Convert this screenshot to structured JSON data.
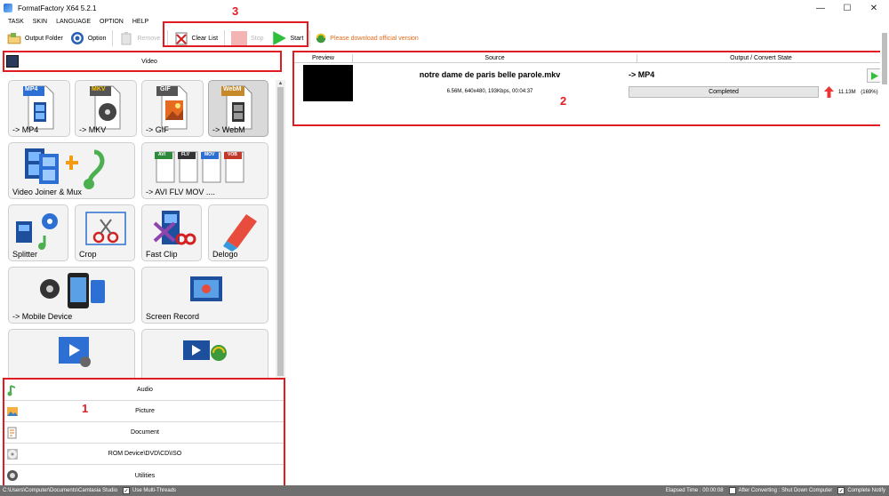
{
  "window": {
    "title": "FormatFactory X64 5.2.1",
    "controls": {
      "minimize": "—",
      "maximize": "☐",
      "close": "✕"
    }
  },
  "menu": [
    "TASK",
    "SKIN",
    "LANGUAGE",
    "OPTION",
    "HELP"
  ],
  "toolbar": {
    "output_folder": "Output Folder",
    "option": "Option",
    "remove": "Remove",
    "clear_list": "Clear List",
    "stop": "Stop",
    "start": "Start",
    "notice": "Please download official version"
  },
  "annotations": {
    "one": "1",
    "two": "2",
    "three": "3"
  },
  "left": {
    "header": "Video",
    "tiles": [
      {
        "label": "-> MP4",
        "badge": "MP4",
        "icon": "mp4-icon"
      },
      {
        "label": "-> MKV",
        "badge": "MKV",
        "icon": "mkv-icon"
      },
      {
        "label": "-> GIF",
        "badge": "GIF",
        "icon": "gif-icon"
      },
      {
        "label": "-> WebM",
        "badge": "WebM",
        "icon": "webm-icon",
        "selected": true
      },
      {
        "label": "Video Joiner & Mux",
        "icon": "video-joiner-icon"
      },
      {
        "label": "-> AVI FLV MOV ....",
        "icon": "avi-flv-mov-icon",
        "badges": [
          "AVI",
          "FLV",
          "MOV",
          "VOB"
        ]
      },
      {
        "label": "Splitter",
        "icon": "splitter-icon"
      },
      {
        "label": "Crop",
        "icon": "crop-icon"
      },
      {
        "label": "Fast Clip",
        "icon": "fast-clip-icon"
      },
      {
        "label": "Delogo",
        "icon": "delogo-icon"
      },
      {
        "label": "-> Mobile Device",
        "icon": "mobile-device-icon"
      },
      {
        "label": "Screen Record",
        "icon": "screen-record-icon"
      },
      {
        "label": "",
        "icon": "video-player-icon"
      },
      {
        "label": "",
        "icon": "video-download-icon"
      }
    ],
    "categories": [
      {
        "label": "Audio",
        "icon": "music-note-icon"
      },
      {
        "label": "Picture",
        "icon": "picture-icon"
      },
      {
        "label": "Document",
        "icon": "document-icon"
      },
      {
        "label": "ROM Device\\DVD\\CD\\ISO",
        "icon": "disc-icon"
      },
      {
        "label": "Utilities",
        "icon": "utilities-icon"
      }
    ]
  },
  "tasks": {
    "columns": [
      "Preview",
      "Source",
      "Output / Convert State"
    ],
    "items": [
      {
        "filename": "notre dame de paris belle parole.mkv",
        "info": "6.56M, 640x480, 193Kbps, 00:04:37",
        "target": "-> MP4",
        "state": "Completed",
        "progress": 1.0,
        "output_size": "11.13M",
        "ratio": "(169%)"
      }
    ]
  },
  "status": {
    "path": "C:\\Users\\Computer\\Documents\\Camtasia Studio",
    "multithreads": "Use Multi-Threads",
    "elapsed": "Elapsed Time : 00:00:08",
    "after_converting": "After Converting : Shut Down Computer",
    "complete_notify": "Complete Notify"
  },
  "colors": {
    "annotation": "#e11b22",
    "notice": "#e06a1a",
    "status_bg": "#6f6f6f"
  }
}
